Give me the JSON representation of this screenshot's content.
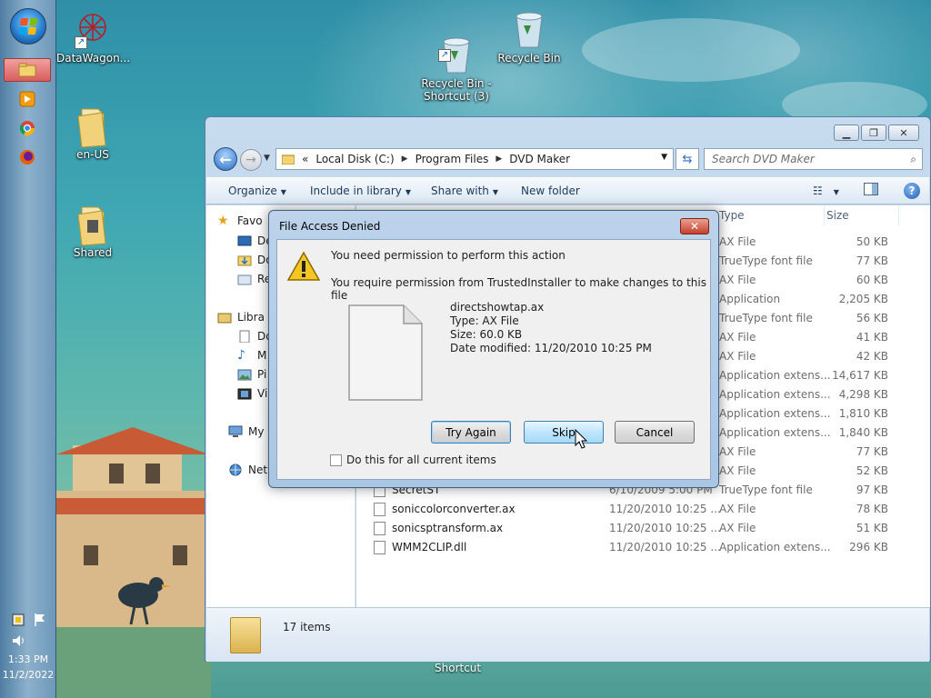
{
  "desktop": {
    "icons": [
      {
        "label": "DataWagon..."
      },
      {
        "label": "Recycle Bin -\nShortcut (3)"
      },
      {
        "label": "Recycle Bin"
      },
      {
        "label": "en-US"
      },
      {
        "label": "Shared"
      }
    ],
    "bottom_label": "Shortcut"
  },
  "taskbar": {
    "time": "1:33 PM",
    "date": "11/2/2022"
  },
  "explorer": {
    "breadcrumb": [
      "Local Disk (C:)",
      "Program Files",
      "DVD Maker"
    ],
    "breadcrumb_prefix": "«",
    "search_placeholder": "Search DVD Maker",
    "toolbar": {
      "organize": "Organize",
      "include_in_library": "Include in library",
      "share_with": "Share with",
      "new_folder": "New folder"
    },
    "nav": {
      "favorites": "Favo",
      "fav_items": [
        "De",
        "Do",
        "Re"
      ],
      "libraries": "Libra",
      "lib_items": [
        "Do",
        "M",
        "Pi",
        "Vi"
      ],
      "computer": "My C",
      "network": "Netw"
    },
    "columns": {
      "type": "Type",
      "size": "Size"
    },
    "rows": [
      {
        "name": "",
        "date": "",
        "type": "AX File",
        "size": "50 KB"
      },
      {
        "name": "",
        "date": "",
        "type": "TrueType font file",
        "size": "77 KB"
      },
      {
        "name": "",
        "date": "",
        "type": "AX File",
        "size": "60 KB"
      },
      {
        "name": "",
        "date": "",
        "type": "Application",
        "size": "2,205 KB"
      },
      {
        "name": "",
        "date": "",
        "type": "TrueType font file",
        "size": "56 KB"
      },
      {
        "name": "",
        "date": "",
        "type": "AX File",
        "size": "41 KB"
      },
      {
        "name": "",
        "date": "",
        "type": "AX File",
        "size": "42 KB"
      },
      {
        "name": "",
        "date": "",
        "type": "Application extens...",
        "size": "14,617 KB"
      },
      {
        "name": "",
        "date": "",
        "type": "Application extens...",
        "size": "4,298 KB"
      },
      {
        "name": "",
        "date": "",
        "type": "Application extens...",
        "size": "1,810 KB"
      },
      {
        "name": "",
        "date": "",
        "type": "Application extens...",
        "size": "1,840 KB"
      },
      {
        "name": "",
        "date": "",
        "type": "AX File",
        "size": "77 KB"
      },
      {
        "name": "",
        "date": "",
        "type": "AX File",
        "size": "52 KB"
      },
      {
        "name": "SecretST",
        "date": "6/10/2009 5:00 PM",
        "type": "TrueType font file",
        "size": "97 KB"
      },
      {
        "name": "soniccolorconverter.ax",
        "date": "11/20/2010 10:25 ...",
        "type": "AX File",
        "size": "78 KB"
      },
      {
        "name": "sonicsptransform.ax",
        "date": "11/20/2010 10:25 ...",
        "type": "AX File",
        "size": "51 KB"
      },
      {
        "name": "WMM2CLIP.dll",
        "date": "11/20/2010 10:25 ...",
        "type": "Application extens...",
        "size": "296 KB"
      }
    ],
    "status": "17 items"
  },
  "dialog": {
    "title": "File Access Denied",
    "heading": "You need permission to perform this action",
    "message": "You require permission from TrustedInstaller to make changes to this file",
    "file": {
      "name": "directshowtap.ax",
      "type": "Type: AX File",
      "size": "Size: 60.0 KB",
      "modified": "Date modified: 11/20/2010 10:25 PM"
    },
    "buttons": {
      "try_again": "Try Again",
      "skip": "Skip",
      "cancel": "Cancel"
    },
    "checkbox_label": "Do this for all current items"
  }
}
